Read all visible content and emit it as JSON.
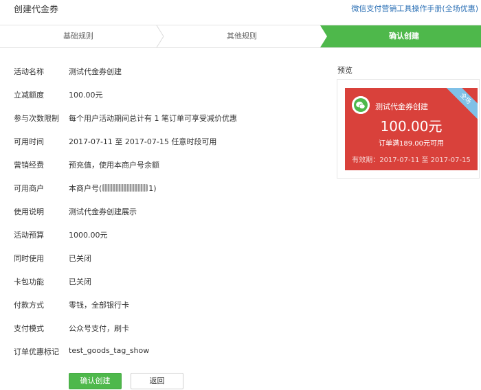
{
  "header": {
    "title": "创建代金券",
    "manual_link": "微信支付营销工具操作手册(全场优惠)"
  },
  "steps": [
    {
      "label": "基础规则"
    },
    {
      "label": "其他规则"
    },
    {
      "label": "确认创建"
    }
  ],
  "colors": {
    "accent": "#4eb84b",
    "coupon": "#d9413b",
    "link": "#2a6fb5",
    "ribbon": "#7fc0e7"
  },
  "form": {
    "rows": [
      {
        "key": "活动名称",
        "value": "测试代金券创建"
      },
      {
        "key": "立减额度",
        "value": "100.00元"
      },
      {
        "key": "参与次数限制",
        "value": "每个用户活动期间总计有 1 笔订单可享受减价优惠"
      },
      {
        "key": "可用时间",
        "value": "2017-07-11 至 2017-07-15 任意时段可用"
      },
      {
        "key": "营销经费",
        "value": "预充值，使用本商户号余额"
      },
      {
        "key": "可用商户",
        "value": "本商户号(",
        "value_suffix": "1)"
      },
      {
        "key": "使用说明",
        "value": "测试代金券创建展示"
      },
      {
        "key": "活动预算",
        "value": "1000.00元"
      },
      {
        "key": "同时使用",
        "value": "已关闭"
      },
      {
        "key": "卡包功能",
        "value": "已关闭"
      },
      {
        "key": "付款方式",
        "value": "零钱，全部银行卡"
      },
      {
        "key": "支付模式",
        "value": "公众号支付，刷卡"
      },
      {
        "key": "订单优惠标记",
        "value": "test_goods_tag_show"
      }
    ]
  },
  "buttons": {
    "confirm": "确认创建",
    "back": "返回"
  },
  "preview": {
    "label": "预览",
    "coupon": {
      "name": "测试代金券创建",
      "amount": "100.00元",
      "condition": "订单满189.00元可用",
      "valid": "有效期：2017-07-11 至 2017-07-15",
      "ribbon": "全场",
      "icon": "wechat-icon"
    }
  }
}
